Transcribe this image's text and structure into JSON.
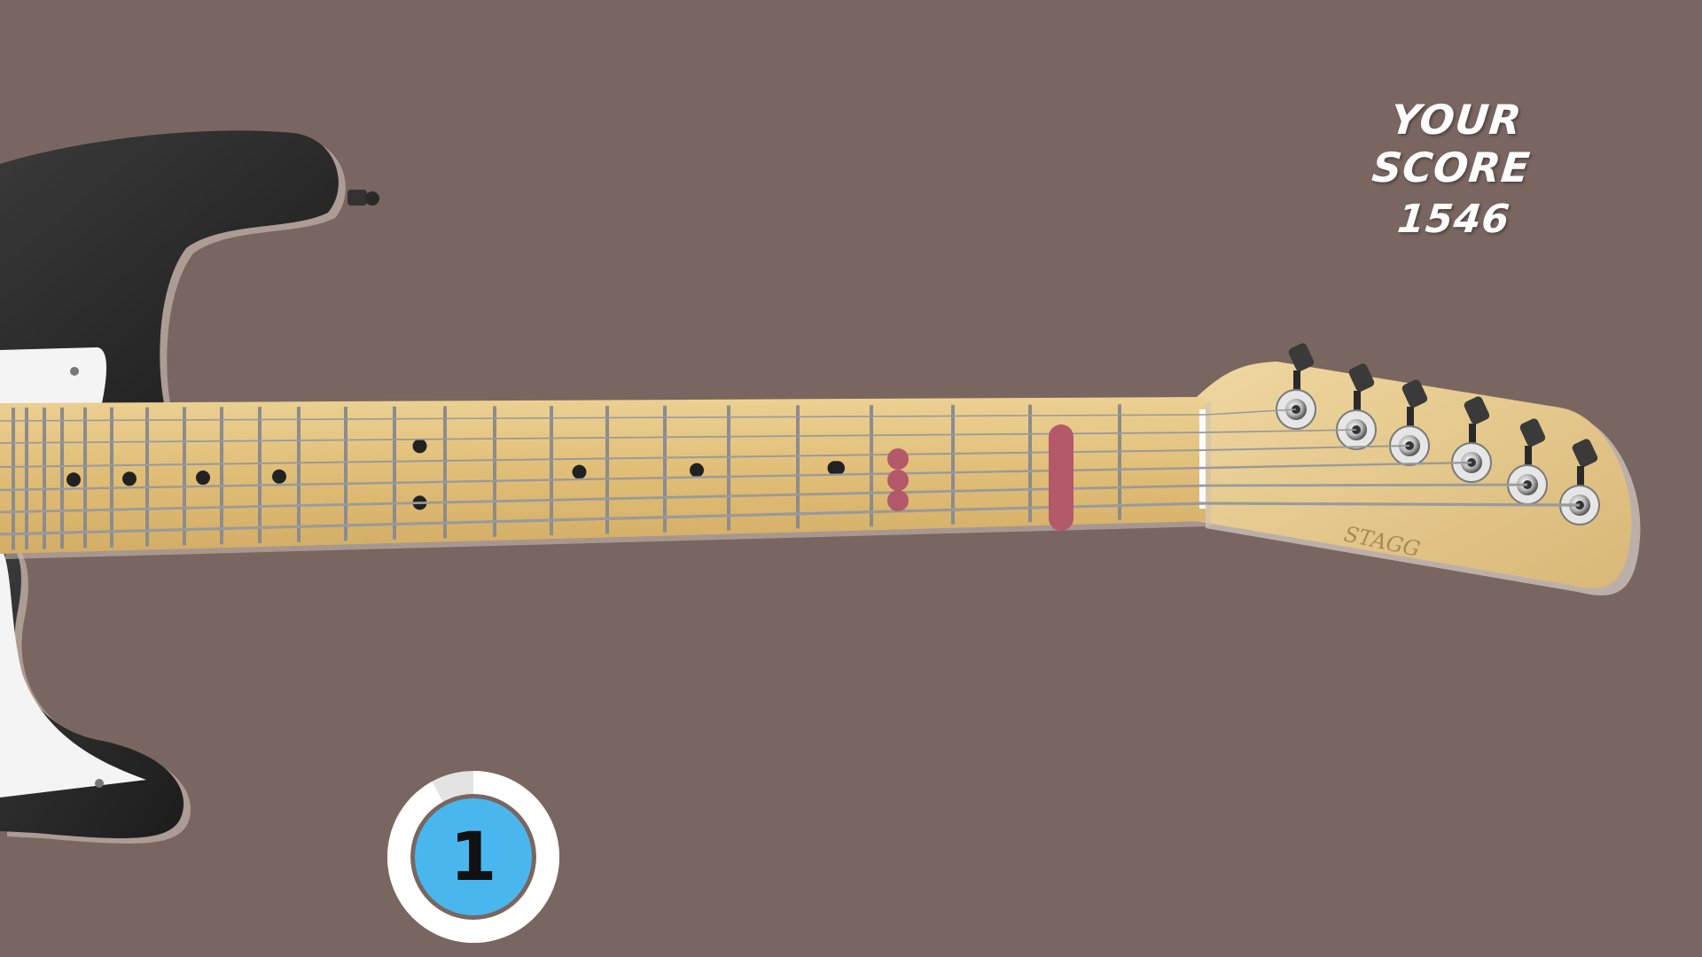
{
  "hud": {
    "score_label": "YOUR SCORE",
    "score_value": "1546",
    "timer_value": "1",
    "timer_progress": 0.92
  },
  "guitar": {
    "brand": "STAGG",
    "frets": 25,
    "strings": 6,
    "single_dot_fret_markers": [
      3,
      5,
      7,
      9,
      15,
      17,
      19,
      21
    ],
    "double_dot_fret_markers": [
      12
    ],
    "highlighted_notes": {
      "chord_dots_fret": 3,
      "chord_dot_strings": [
        3,
        4
      ],
      "bar_fret": 1,
      "bar_string_range": [
        1,
        6
      ]
    }
  },
  "colors": {
    "background": "#7a6660",
    "fretboard": "#e2c07a",
    "headstock": "#e8c98c",
    "body_black": "#2b2b2b",
    "pickguard": "#f4f4f4",
    "highlight": "#b3596a",
    "timer_ring": "#e3e3e3",
    "timer_fill": "#49b7ee"
  }
}
